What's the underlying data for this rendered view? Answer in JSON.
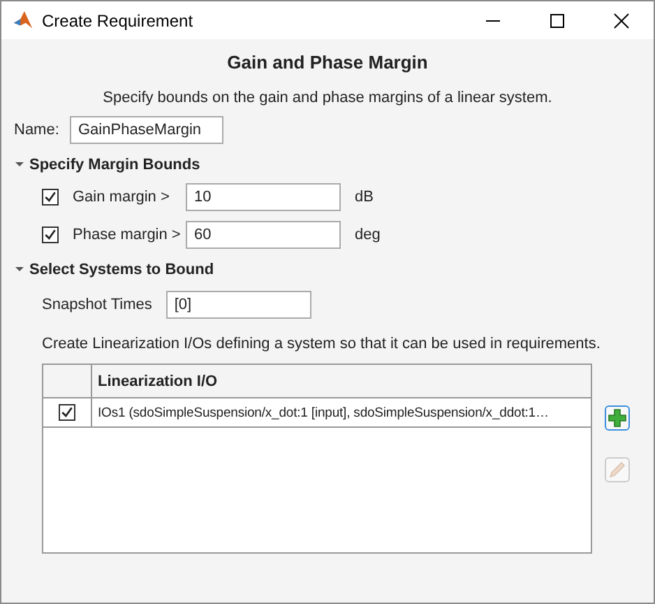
{
  "window": {
    "title": "Create Requirement"
  },
  "heading": "Gain and Phase Margin",
  "description": "Specify bounds on the gain and phase margins of a linear system.",
  "name_field": {
    "label": "Name:",
    "value": "GainPhaseMargin"
  },
  "margin_section": {
    "title": "Specify Margin Bounds",
    "expanded": true,
    "rows": [
      {
        "label": "Gain margin >",
        "checked": true,
        "value": "10",
        "unit": "dB"
      },
      {
        "label": "Phase margin >",
        "checked": true,
        "value": "60",
        "unit": "deg"
      }
    ]
  },
  "systems_section": {
    "title": "Select Systems to Bound",
    "expanded": true,
    "snapshot": {
      "label": "Snapshot Times",
      "value": "[0]"
    },
    "hint": "Create Linearization I/Os defining a system so that it can be used in requirements.",
    "table": {
      "columns": [
        "Linearization I/O"
      ],
      "rows": [
        {
          "checked": true,
          "text": "IOs1 (sdoSimpleSuspension/x_dot:1 [input], sdoSimpleSuspension/x_ddot:1…"
        }
      ]
    },
    "table_buttons": [
      {
        "kind": "add",
        "disabled": false
      },
      {
        "kind": "edit",
        "disabled": true
      }
    ]
  }
}
